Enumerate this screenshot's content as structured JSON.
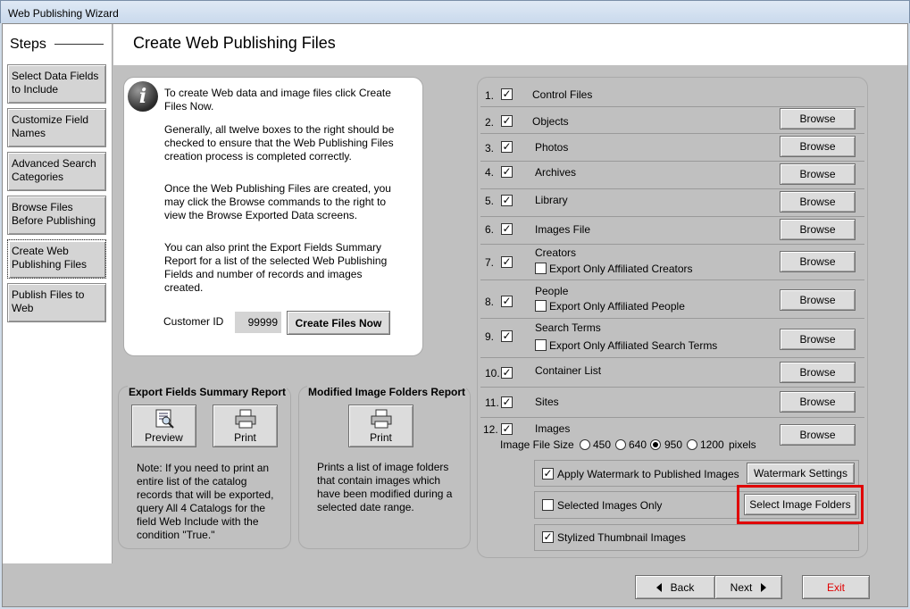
{
  "window": {
    "title": "Web Publishing Wizard"
  },
  "header": {
    "title": "Create Web Publishing Files"
  },
  "sidebar": {
    "label": "Steps",
    "items": [
      {
        "label": "Select Data Fields to Include"
      },
      {
        "label": "Customize Field Names"
      },
      {
        "label": "Advanced Search Categories"
      },
      {
        "label": "Browse Files Before Publishing"
      },
      {
        "label": "Create Web Publishing Files"
      },
      {
        "label": "Publish Files to Web"
      }
    ]
  },
  "info": {
    "p1": "To create Web data and image files click Create Files Now.",
    "p2": "Generally, all twelve boxes to the right should be checked to ensure that the Web Publishing Files creation process is completed correctly.",
    "p3": "Once the Web Publishing Files are created, you may click the Browse commands to the right to view the Browse Exported Data screens.",
    "p4": "You can also print the Export Fields Summary Report for a list of the selected Web Publishing Fields and number of records and images created.",
    "customer_id_label": "Customer ID",
    "customer_id_value": "99999",
    "create_button": "Create Files Now"
  },
  "export_report": {
    "title": "Export Fields Summary Report",
    "preview": "Preview",
    "print": "Print",
    "note": "Note: If you need to print an entire list of the catalog records that will be exported, query All 4 Catalogs for the field Web Include with the condition \"True.\""
  },
  "image_report": {
    "title": "Modified Image Folders Report",
    "print": "Print",
    "note": "Prints a list of image folders that contain images which have been modified during a selected date range."
  },
  "files": {
    "browse_label": "Browse",
    "check_mark": "✓",
    "items": [
      {
        "num": "1.",
        "label": "Control Files",
        "checked": true
      },
      {
        "num": "2.",
        "label": "Objects",
        "checked": true
      },
      {
        "num": "3.",
        "label": "Photos",
        "checked": true
      },
      {
        "num": "4.",
        "label": "Archives",
        "checked": true
      },
      {
        "num": "5.",
        "label": "Library",
        "checked": true
      },
      {
        "num": "6.",
        "label": "Images File",
        "checked": true
      },
      {
        "num": "7.",
        "label": "Creators",
        "checked": true,
        "sub": "Export Only Affiliated Creators"
      },
      {
        "num": "8.",
        "label": "People",
        "checked": true,
        "sub": "Export Only Affiliated People"
      },
      {
        "num": "9.",
        "label": "Search Terms",
        "checked": true,
        "sub": "Export Only Affiliated Search Terms"
      },
      {
        "num": "10.",
        "label": "Container List",
        "checked": true
      },
      {
        "num": "11.",
        "label": "Sites",
        "checked": true
      },
      {
        "num": "12.",
        "label": "Images",
        "checked": true
      }
    ],
    "image_size": {
      "label": "Image File Size",
      "options": [
        "450",
        "640",
        "950",
        "1200"
      ],
      "selected": "950",
      "unit": "pixels"
    },
    "watermark": {
      "label": "Apply Watermark to Published Images",
      "checked": true,
      "button": "Watermark Settings"
    },
    "selected_only": {
      "label": "Selected Images Only",
      "checked": false,
      "button": "Select Image Folders",
      "highlight_color": "#e00000"
    },
    "thumbnails": {
      "label": "Stylized Thumbnail Images",
      "checked": true
    }
  },
  "nav": {
    "back": "Back",
    "next": "Next",
    "exit": "Exit"
  }
}
